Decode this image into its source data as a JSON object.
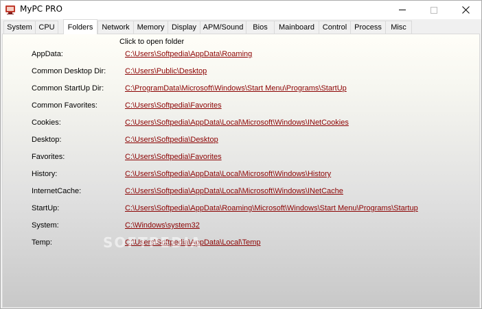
{
  "window": {
    "title": "MyPC PRO",
    "icon": "mypc-app-icon"
  },
  "tabs": [
    {
      "label": "System"
    },
    {
      "label": "CPU"
    },
    {
      "label": "Folders",
      "active": true
    },
    {
      "label": "Network"
    },
    {
      "label": "Memory"
    },
    {
      "label": "Display"
    },
    {
      "label": "APM/Sound"
    },
    {
      "label": "Bios"
    },
    {
      "label": "Mainboard"
    },
    {
      "label": "Control"
    },
    {
      "label": "Process"
    },
    {
      "label": "Misc"
    }
  ],
  "folders": {
    "hint": "Click to open folder",
    "rows": [
      {
        "label": "AppData:",
        "path": "C:\\Users\\Softpedia\\AppData\\Roaming"
      },
      {
        "label": "Common Desktop Dir:",
        "path": "C:\\Users\\Public\\Desktop"
      },
      {
        "label": "Common StartUp Dir:",
        "path": "C:\\ProgramData\\Microsoft\\Windows\\Start Menu\\Programs\\StartUp"
      },
      {
        "label": "Common Favorites:",
        "path": "C:\\Users\\Softpedia\\Favorites"
      },
      {
        "label": "Cookies:",
        "path": "C:\\Users\\Softpedia\\AppData\\Local\\Microsoft\\Windows\\INetCookies"
      },
      {
        "label": "Desktop:",
        "path": "C:\\Users\\Softpedia\\Desktop"
      },
      {
        "label": "Favorites:",
        "path": "C:\\Users\\Softpedia\\Favorites"
      },
      {
        "label": "History:",
        "path": "C:\\Users\\Softpedia\\AppData\\Local\\Microsoft\\Windows\\History"
      },
      {
        "label": "InternetCache:",
        "path": "C:\\Users\\Softpedia\\AppData\\Local\\Microsoft\\Windows\\INetCache"
      },
      {
        "label": "StartUp:",
        "path": "C:\\Users\\Softpedia\\AppData\\Roaming\\Microsoft\\Windows\\Start Menu\\Programs\\Startup"
      },
      {
        "label": "System:",
        "path": "C:\\Windows\\system32"
      },
      {
        "label": "Temp:",
        "path": "C:\\Users\\Softpedia\\AppData\\Local\\Temp"
      }
    ]
  },
  "watermark": "SOFTPEDIA",
  "colors": {
    "link": "#8b0000"
  }
}
